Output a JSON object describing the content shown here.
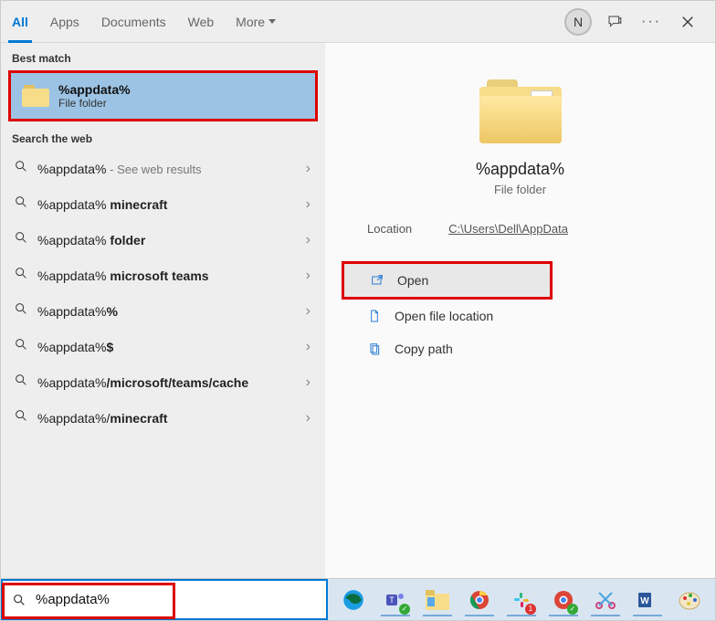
{
  "tabs": {
    "all": "All",
    "apps": "Apps",
    "documents": "Documents",
    "web": "Web",
    "more": "More"
  },
  "avatar_initial": "N",
  "sections": {
    "best_match": "Best match",
    "search_web": "Search the web"
  },
  "best_match": {
    "title": "%appdata%",
    "subtitle": "File folder"
  },
  "suggestions": [
    {
      "prefix": "%appdata%",
      "suffix": "",
      "hint": " - See web results"
    },
    {
      "prefix": "%appdata% ",
      "suffix": "minecraft",
      "hint": ""
    },
    {
      "prefix": "%appdata% ",
      "suffix": "folder",
      "hint": ""
    },
    {
      "prefix": "%appdata% ",
      "suffix": "microsoft teams",
      "hint": ""
    },
    {
      "prefix": "%appdata%",
      "suffix": "%",
      "hint": ""
    },
    {
      "prefix": "%appdata%",
      "suffix": "$",
      "hint": ""
    },
    {
      "prefix": "%appdata%",
      "suffix": "/microsoft/teams/cache",
      "hint": ""
    },
    {
      "prefix": "%appdata%/",
      "suffix": "minecraft",
      "hint": ""
    }
  ],
  "preview": {
    "title": "%appdata%",
    "subtitle": "File folder",
    "location_label": "Location",
    "location_value": "C:\\Users\\Dell\\AppData"
  },
  "actions": {
    "open": "Open",
    "open_location": "Open file location",
    "copy_path": "Copy path"
  },
  "search_value": "%appdata%",
  "taskbar_badge": "1"
}
